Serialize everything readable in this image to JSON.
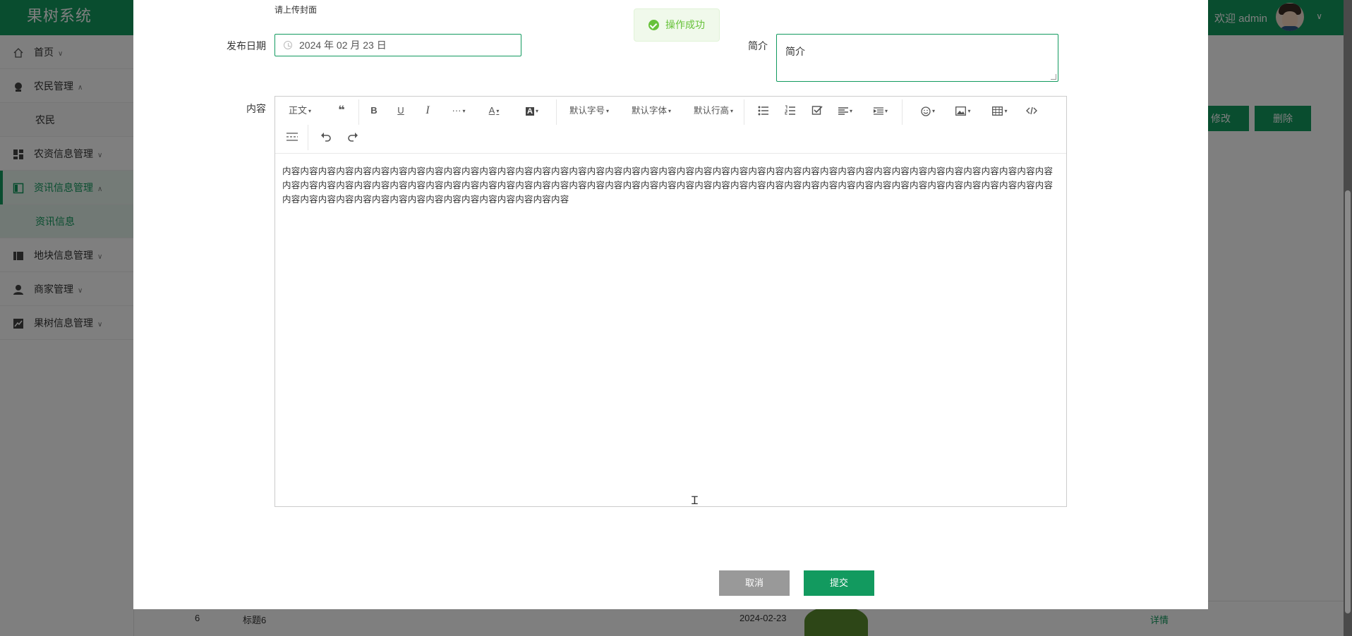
{
  "app": {
    "title": "果树系统",
    "welcome": "欢迎 admin",
    "user_caret": "∨"
  },
  "sidebar": {
    "items": [
      {
        "label": "首页",
        "caret": "∨",
        "icon": "home-icon"
      },
      {
        "label": "农民管理",
        "caret": "∧",
        "icon": "farmer-icon"
      },
      {
        "label": "农民",
        "sub": true
      },
      {
        "label": "农资信息管理",
        "caret": "∨",
        "icon": "grid-icon"
      },
      {
        "label": "资讯信息管理",
        "caret": "∧",
        "icon": "news-icon",
        "active": true
      },
      {
        "label": "资讯信息",
        "sub": true,
        "active": true
      },
      {
        "label": "地块信息管理",
        "caret": "∨",
        "icon": "plot-icon"
      },
      {
        "label": "商家管理",
        "caret": "∨",
        "icon": "merchant-icon"
      },
      {
        "label": "果树信息管理",
        "caret": "∨",
        "icon": "tree-icon"
      }
    ]
  },
  "background": {
    "buttons": {
      "edit": "修改",
      "delete": "删除"
    },
    "row": {
      "index": "6",
      "title": "标题6",
      "date": "2024-02-23",
      "action": "详情"
    }
  },
  "dialog": {
    "cover_hint": "请上传封面",
    "date_label": "发布日期",
    "date_value": "2024 年 02 月 23 日",
    "summary_label": "简介",
    "summary_value": "简介",
    "content_label": "内容",
    "content_text": "内容内容内容内容内容内容内容内容内容内容内容内容内容内容内容内容内容内容内容内容内容内容内容内容内容内容内容内容内容内容内容内容内容内容内容内容内容内容内容内容内容内容内容内容内容内容内容内容内容内容内容内容内容内容内容内容内容内容内容内容内容内容内容内容内容内容内容内容内容内容内容内容内容内容内容内容内容内容内容内容内容内容内容内容内容内容内容内容内容内容内容内容内容内容内容内容内容内容内容内容内容内容",
    "cancel": "取消",
    "submit": "提交"
  },
  "toolbar": {
    "paragraph": "正文",
    "quote": "❝",
    "bold": "B",
    "underline": "U",
    "italic": "I",
    "more": "···",
    "font_color": "A",
    "bg_color": "A",
    "font_size": "默认字号",
    "font_family": "默认字体",
    "line_height": "默认行高",
    "dropdown": "▾"
  },
  "toast": {
    "message": "操作成功"
  },
  "colors": {
    "primary": "#129a5f",
    "success": "#67c23a",
    "cancel": "#999999"
  }
}
